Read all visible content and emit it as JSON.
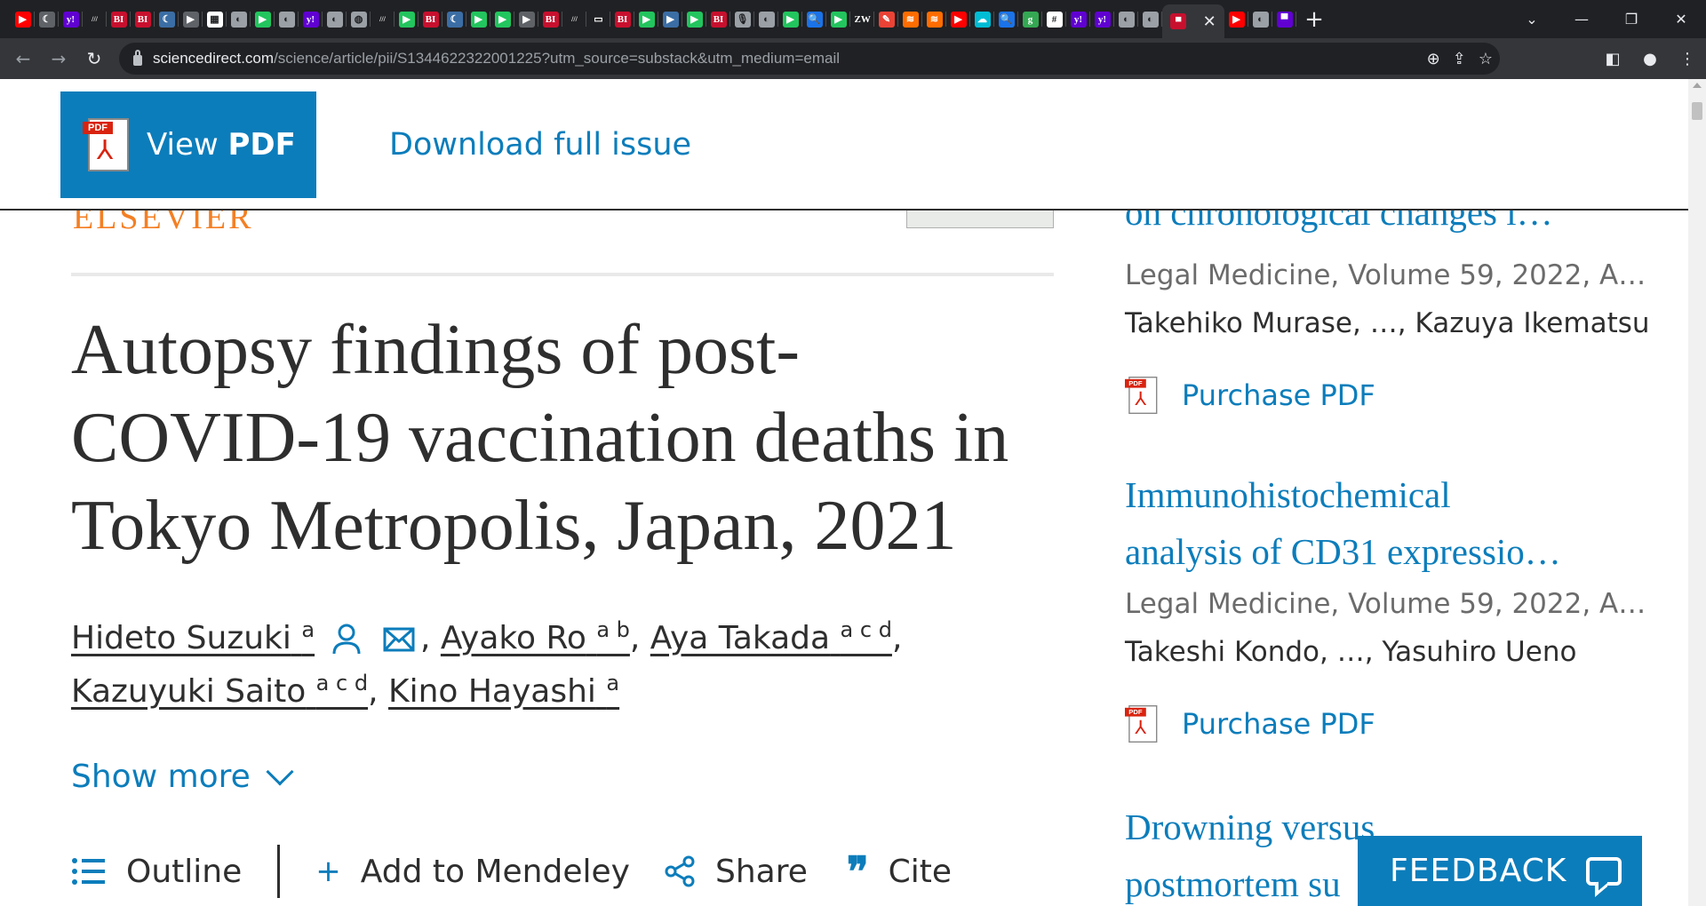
{
  "browser": {
    "tab_colors": [
      "#ff0000",
      "#5f6368",
      "#6001d2",
      "#202124",
      "#c8102e",
      "#c8102e",
      "#3b6ea5",
      "#5f6368",
      "#ffffff",
      "#9aa0a6",
      "#22c55e",
      "#9aa0a6",
      "#6001d2",
      "#9aa0a6",
      "#9aa0a6",
      "#202124",
      "#22c55e",
      "#c8102e",
      "#3b6ea5",
      "#22c55e",
      "#22c55e",
      "#5f6368",
      "#c8102e",
      "#202124",
      "#202124",
      "#c8102e",
      "#22c55e",
      "#3b6ea5",
      "#22c55e",
      "#c8102e",
      "#9aa0a6",
      "#9aa0a6",
      "#22c55e",
      "#1a73e8",
      "#22c55e",
      "#202124",
      "#ea4335",
      "#ff6d00",
      "#ff6d00",
      "#ff0000",
      "#00bcd4",
      "#1a73e8",
      "#34a853",
      "#ffffff",
      "#6001d2",
      "#6001d2",
      "#9aa0a6",
      "#9aa0a6",
      "#ff0000",
      "#9aa0a6",
      "#6001d2"
    ],
    "tab_glyphs": [
      "▶",
      "☾",
      "y!",
      "///",
      "BI",
      "BI",
      "☾",
      "▶",
      "▦",
      "◐",
      "▶",
      "◐",
      "y!",
      "◐",
      "◍",
      "///",
      "▶",
      "BI",
      "☾",
      "▶",
      "▶",
      "▶",
      "BI",
      "///",
      "▭",
      "BI",
      "▶",
      "▶",
      "▶",
      "BI",
      "🎙",
      "◐",
      "▶",
      "🔍",
      "▶",
      "ZW",
      "✎",
      "≋",
      "≋",
      "▶",
      "☁",
      "🔍",
      "g",
      "#",
      "y!",
      "y!",
      "◐",
      "◐",
      "▶",
      "◐",
      "▀"
    ],
    "active_tab_glyph": "y!",
    "url_host": "sciencedirect.com",
    "url_path": "/science/article/pii/S1344622322001225?utm_source=substack&utm_medium=email"
  },
  "header": {
    "view_pdf_prefix": "View ",
    "view_pdf_bold": "PDF",
    "download_full_issue": "Download full issue",
    "pdf_tag": "PDF"
  },
  "publisher_logo": "ELSEVIER",
  "article": {
    "title_lines": [
      "Autopsy findings of post-",
      "COVID-19 vaccination deaths in",
      "Tokyo Metropolis, Japan, 2021"
    ],
    "authors": [
      {
        "name": "Hideto Suzuki",
        "aff": "a"
      },
      {
        "name": "Ayako Ro",
        "aff": "a b"
      },
      {
        "name": "Aya Takada",
        "aff": "a c d"
      },
      {
        "name": "Kazuyuki Saito",
        "aff": "a c d"
      },
      {
        "name": "Kino Hayashi",
        "aff": "a"
      }
    ],
    "show_more": "Show more",
    "actions": {
      "outline": "Outline",
      "mendeley": "Add to Mendeley",
      "share": "Share",
      "cite": "Cite"
    }
  },
  "recommended": [
    {
      "title": "on chronological changes i…",
      "meta": "Legal Medicine, Volume 59, 2022, A…",
      "authors": "Takehiko Murase, …, Kazuya Ikematsu",
      "purchase": "Purchase PDF"
    },
    {
      "title_lines": [
        "Immunohistochemical",
        "analysis of CD31 expressio…"
      ],
      "meta": "Legal Medicine, Volume 59, 2022, A…",
      "authors": "Takeshi Kondo, …, Yasuhiro Ueno",
      "purchase": "Purchase PDF"
    },
    {
      "title_lines": [
        "Drowning versus",
        "postmortem su"
      ]
    }
  ],
  "feedback": "FEEDBACK"
}
